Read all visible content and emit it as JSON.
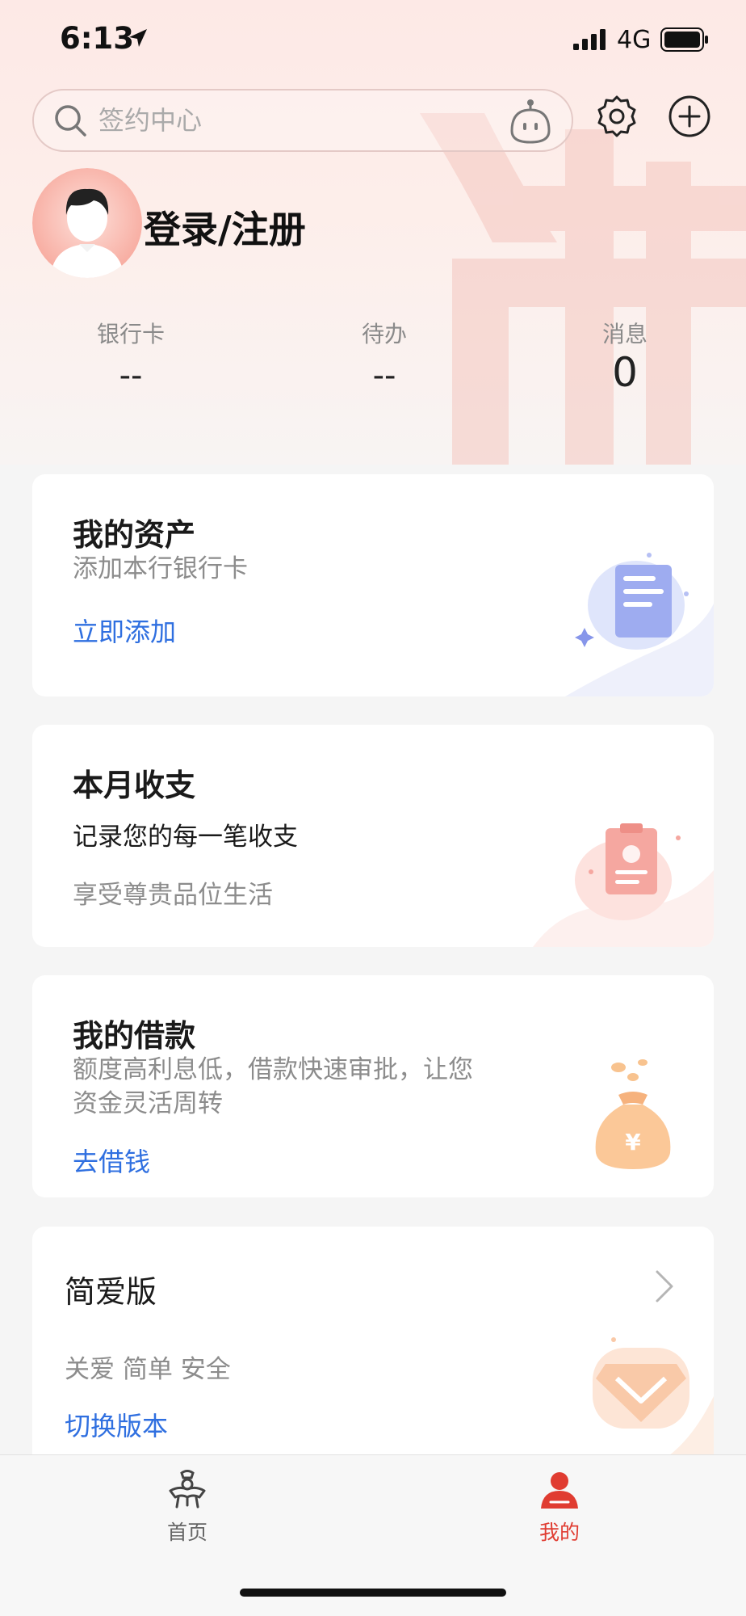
{
  "status_bar": {
    "time": "6:13",
    "network": "4G"
  },
  "search": {
    "placeholder": "签约中心"
  },
  "profile": {
    "login_label": "登录/注册"
  },
  "stats": [
    {
      "label": "银行卡",
      "value": "--"
    },
    {
      "label": "待办",
      "value": "--"
    },
    {
      "label": "消息",
      "value": "0"
    }
  ],
  "cards": {
    "assets": {
      "title": "我的资产",
      "subtitle": "添加本行银行卡",
      "link": "立即添加"
    },
    "monthly": {
      "title": "本月收支",
      "subtitle": "记录您的每一笔收支",
      "subtitle2": "享受尊贵品位生活"
    },
    "loan": {
      "title": "我的借款",
      "subtitle_line1": "额度高利息低，借款快速审批，让您",
      "subtitle_line2": "资金灵活周转",
      "link": "去借钱"
    },
    "version": {
      "title": "简爱版",
      "subtitle": "关爱 简单 安全",
      "link": "切换版本"
    }
  },
  "tabbar": {
    "home": {
      "label": "首页",
      "color": "#666666"
    },
    "mine": {
      "label": "我的",
      "color": "#e03c31"
    }
  },
  "colors": {
    "accent": "#e03c31",
    "link": "#2f6fe0"
  }
}
